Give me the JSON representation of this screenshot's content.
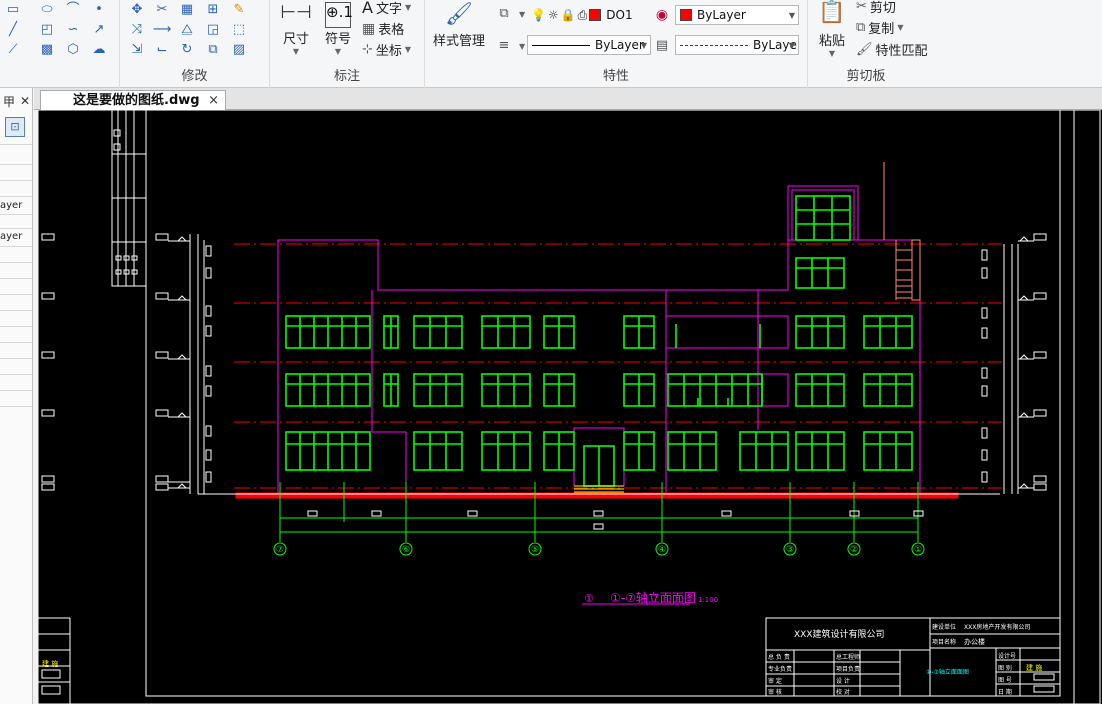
{
  "ribbon": {
    "groups": {
      "modify": "修改",
      "annotate": "标注",
      "properties": "特性",
      "clipboard": "剪切板"
    },
    "annotate": {
      "dimension": "尺寸",
      "symbol": "符号",
      "text": "文字",
      "table": "表格",
      "coordinate": "坐标",
      "style_manager": "样式管理"
    },
    "properties": {
      "layer_value": "DO1",
      "color_value": "ByLayer",
      "linetype_value": "ByLayer",
      "lineweight_value": "ByLaye",
      "color_accent": "#ff0000"
    },
    "clipboard": {
      "paste": "粘贴",
      "cut": "剪切",
      "copy": "复制",
      "match_properties": "特性匹配"
    }
  },
  "palette": {
    "header_label": "甲",
    "rows": [
      "ayer",
      "ayer"
    ]
  },
  "tab": {
    "title": "这是要做的图纸.dwg",
    "close": "×"
  },
  "drawing": {
    "title": "①-⑦轴立面面图",
    "title_prefix": "①",
    "scale": "1:100",
    "axes": [
      "⑦",
      "⑥",
      "⑤",
      "④",
      "③",
      "②",
      "①"
    ],
    "company": "XXX建筑设计有限公司",
    "client_label": "建设单位",
    "client_value": "XXX房地产开发有限公司",
    "project_label": "项目名称",
    "project_value": "办公楼",
    "drawing_label": "①-⑦轴立面面图",
    "sign_rows": [
      "总 负 责",
      "专业负责",
      "审   定",
      "审   核"
    ],
    "sign_rows2": [
      "总工程师",
      "项目负责",
      "设   计",
      "校   对"
    ],
    "right_labels": [
      "设计号",
      "图 别",
      "图 号",
      "日 期"
    ],
    "right_values": [
      "",
      "建 施",
      "",
      ""
    ],
    "stamp_left": "建 施",
    "stamp_right": "建 施",
    "colors": {
      "frame": "#ffffff",
      "window": "#00ff00",
      "wall": "#ff00ff",
      "floorline": "#ff0000",
      "axis": "#00ff00",
      "stair": "#ff8c6a"
    }
  }
}
